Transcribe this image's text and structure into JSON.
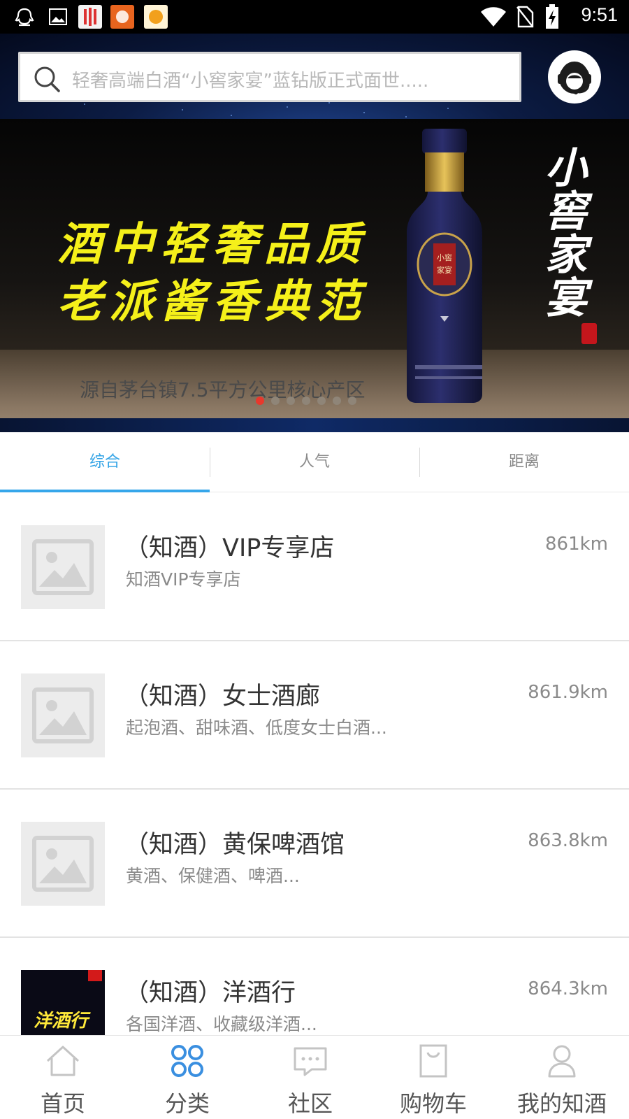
{
  "status_bar": {
    "time": "9:51",
    "left_icons": [
      "qq-icon",
      "image-icon",
      "app-icon-1",
      "app-icon-2",
      "app-icon-3"
    ],
    "right_icons": [
      "wifi-icon",
      "no-sim-icon",
      "battery-charging-icon"
    ]
  },
  "header": {
    "search_placeholder": "轻奢高端白酒“小窖家宴”蓝钻版正式面世.....",
    "service_icon": "customer-service-icon"
  },
  "banner": {
    "slogan_line1": "酒中轻奢品质",
    "slogan_line2": "老派酱香典范",
    "brand_vertical": "小窖家宴",
    "caption": "源自茅台镇7.5平方公里核心产区",
    "total_slides": 7,
    "active_slide": 1,
    "colors": {
      "slogan": "#f5f01a",
      "active_dot": "#e8382c"
    }
  },
  "tabs": [
    {
      "label": "综合",
      "active": true
    },
    {
      "label": "人气",
      "active": false
    },
    {
      "label": "距离",
      "active": false
    }
  ],
  "shops": [
    {
      "name": "（知酒）VIP专享店",
      "desc": "知酒VIP专享店",
      "distance": "861km",
      "thumb": "placeholder"
    },
    {
      "name": "（知酒）女士酒廊",
      "desc": "起泡酒、甜味酒、低度女士白酒...",
      "distance": "861.9km",
      "thumb": "placeholder"
    },
    {
      "name": "（知酒）黄保啤酒馆",
      "desc": "黄酒、保健酒、啤酒...",
      "distance": "863.8km",
      "thumb": "placeholder"
    },
    {
      "name": "（知酒）洋酒行",
      "desc": "各国洋酒、收藏级洋酒...",
      "distance": "864.3km",
      "thumb": "photo",
      "thumb_text": "洋酒行"
    }
  ],
  "bottom_nav": [
    {
      "label": "首页",
      "icon": "home-icon",
      "active": false
    },
    {
      "label": "分类",
      "icon": "category-icon",
      "active": true
    },
    {
      "label": "社区",
      "icon": "chat-icon",
      "active": false
    },
    {
      "label": "购物车",
      "icon": "cart-bag-icon",
      "active": false
    },
    {
      "label": "我的知酒",
      "icon": "user-icon",
      "active": false
    }
  ],
  "accent_color": "#36a6ea"
}
